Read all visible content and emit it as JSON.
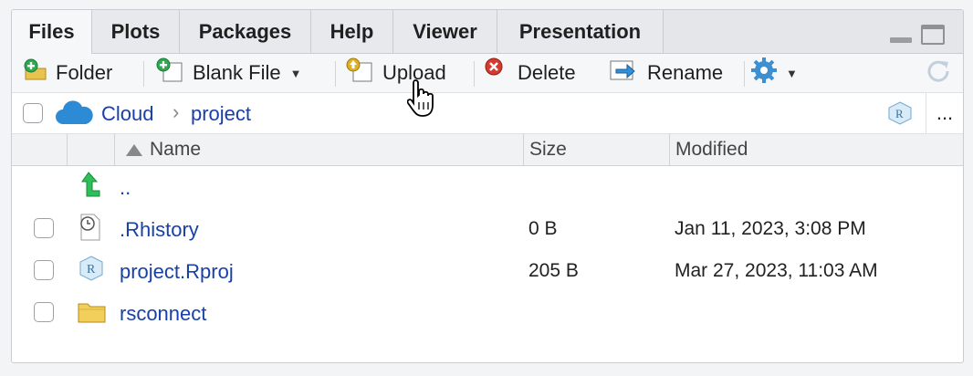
{
  "tabs": [
    {
      "label": "Files",
      "active": true
    },
    {
      "label": "Plots"
    },
    {
      "label": "Packages"
    },
    {
      "label": "Help"
    },
    {
      "label": "Viewer"
    },
    {
      "label": "Presentation"
    }
  ],
  "toolbar": {
    "folder": "Folder",
    "blank_file": "Blank File",
    "upload": "Upload",
    "delete": "Delete",
    "rename": "Rename"
  },
  "breadcrumb": {
    "root": "Cloud",
    "separator": "›",
    "current": "project",
    "more": "..."
  },
  "columns": {
    "name": "Name",
    "size": "Size",
    "modified": "Modified"
  },
  "parent_dir": "..",
  "files": [
    {
      "name": ".Rhistory",
      "size": "0 B",
      "modified": "Jan 11, 2023, 3:08 PM",
      "icon": "rhistory-icon"
    },
    {
      "name": "project.Rproj",
      "size": "205 B",
      "modified": "Mar 27, 2023, 11:03 AM",
      "icon": "rproj-icon"
    },
    {
      "name": "rsconnect",
      "size": "",
      "modified": "",
      "icon": "folder-icon"
    }
  ],
  "colors": {
    "link": "#1840a8",
    "cloud": "#2d8bd6"
  }
}
